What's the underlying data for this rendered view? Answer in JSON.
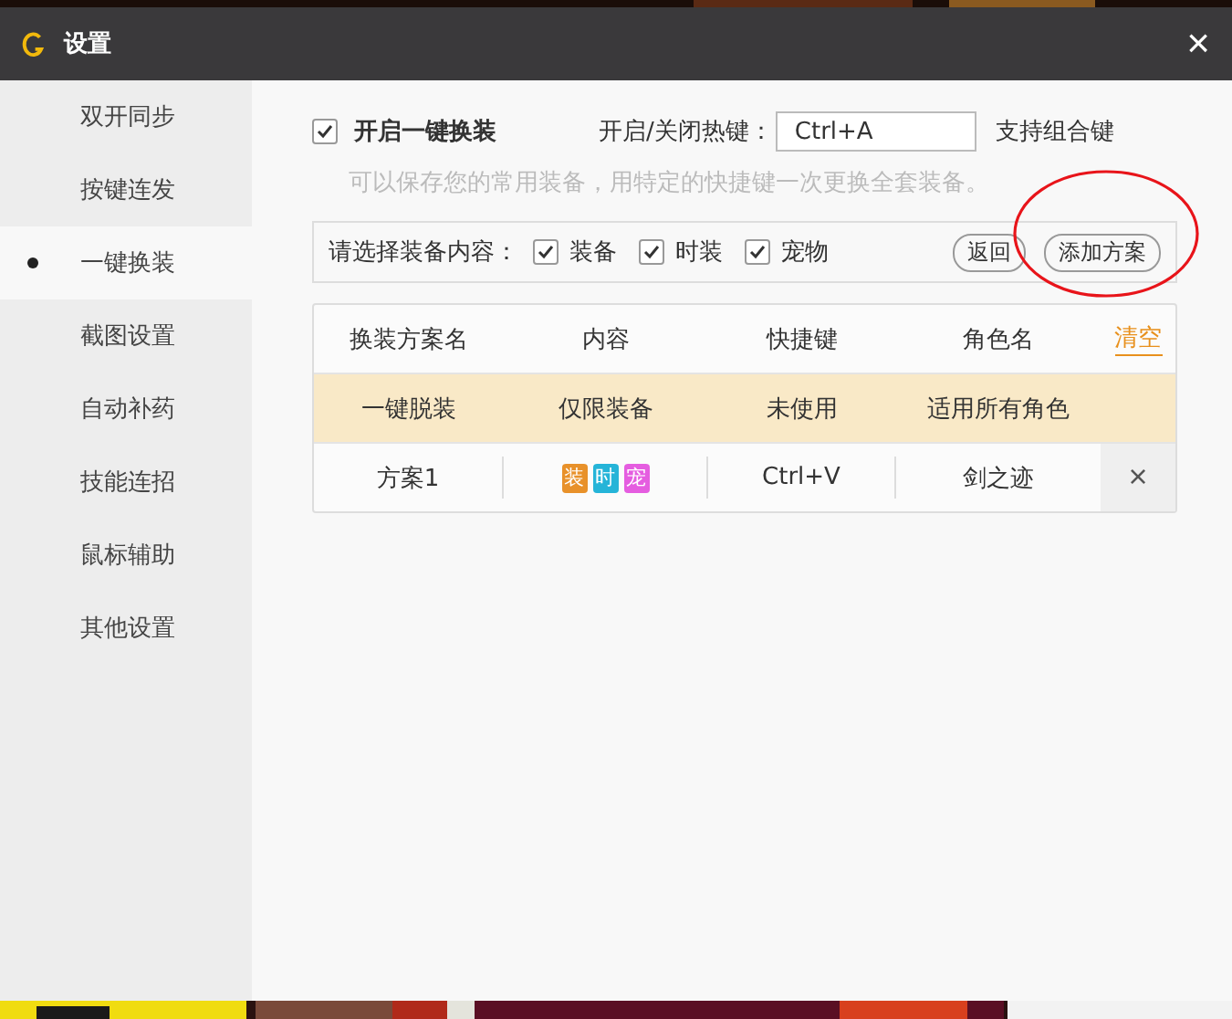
{
  "window": {
    "title": "设置",
    "close": "×"
  },
  "sidebar": {
    "items": [
      {
        "label": "双开同步",
        "selected": false
      },
      {
        "label": "按键连发",
        "selected": false
      },
      {
        "label": "一键换装",
        "selected": true
      },
      {
        "label": "截图设置",
        "selected": false
      },
      {
        "label": "自动补药",
        "selected": false
      },
      {
        "label": "技能连招",
        "selected": false
      },
      {
        "label": "鼠标辅助",
        "selected": false
      },
      {
        "label": "其他设置",
        "selected": false
      }
    ]
  },
  "enable": {
    "label": "开启一键换装",
    "checked": true
  },
  "hotkey": {
    "label": "开启/关闭热键：",
    "value": "Ctrl+A",
    "note": "支持组合键"
  },
  "hint": "可以保存您的常用装备，用特定的快捷键一次更换全套装备。",
  "content_picker": {
    "label": "请选择装备内容：",
    "options": [
      {
        "label": "装备",
        "checked": true
      },
      {
        "label": "时装",
        "checked": true
      },
      {
        "label": "宠物",
        "checked": true
      }
    ],
    "buttons": [
      {
        "label": "返回",
        "highlighted": false
      },
      {
        "label": "添加方案",
        "highlighted": true
      }
    ]
  },
  "table": {
    "columns": [
      "换装方案名",
      "内容",
      "快捷键",
      "角色名"
    ],
    "clear_link": "清空",
    "rows": [
      {
        "kind": "default",
        "name": "一键脱装",
        "content": "仅限装备",
        "hotkey": "未使用",
        "role": "适用所有角色"
      },
      {
        "kind": "custom",
        "name": "方案1",
        "tags": [
          {
            "label": "装",
            "color": "#e8912a"
          },
          {
            "label": "时",
            "color": "#25b4d8"
          },
          {
            "label": "宠",
            "color": "#e55de0"
          }
        ],
        "hotkey": "Ctrl+V",
        "role": "剑之迹",
        "delete": "×"
      }
    ]
  }
}
